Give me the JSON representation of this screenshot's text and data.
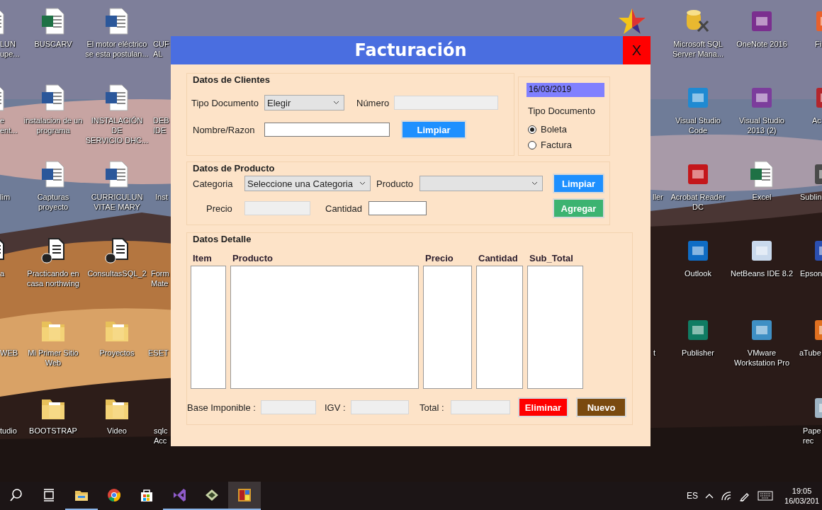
{
  "desktop": {
    "icons": [
      {
        "kind": "word",
        "label": "LUN\nupe..."
      },
      {
        "kind": "excel",
        "label": "BUSCARV"
      },
      {
        "kind": "word",
        "label": "El motor eléctrico\nse esta postulan..."
      },
      {
        "kind": "none",
        "label": "CUF\nAL"
      },
      {
        "kind": "star"
      },
      {
        "kind": "database",
        "label": "Microsoft SQL\nServer Mana..."
      },
      {
        "kind": "app",
        "color": "#7b2f8f",
        "label": "OneNote 2016"
      },
      {
        "kind": "app",
        "color": "#e8612c",
        "label": "Fi"
      },
      {
        "kind": "word",
        "label": "e\nent..."
      },
      {
        "kind": "word",
        "label": "instalacion de un\nprograma"
      },
      {
        "kind": "word",
        "label": "INSTALACIÓN DE\nSERVICIO DHC..."
      },
      {
        "kind": "none",
        "label": "DEB\nIDE"
      },
      {
        "kind": "app",
        "color": "#1f8ad2",
        "label": "Visual Studio\nCode"
      },
      {
        "kind": "app",
        "color": "#7c3d9c",
        "label": "Visual Studio\n2013 (2)"
      },
      {
        "kind": "app",
        "color": "#b3262c",
        "label": "Ac"
      },
      {
        "kind": "none",
        "label": "lim"
      },
      {
        "kind": "word",
        "label": "Capturas\nproyecto"
      },
      {
        "kind": "word",
        "label": "CURRICULUN\nVITAE MARY"
      },
      {
        "kind": "none",
        "label": "Inst"
      },
      {
        "kind": "none",
        "label": "ller"
      },
      {
        "kind": "app",
        "color": "#c4171b",
        "label": "Acrobat Reader\nDC"
      },
      {
        "kind": "excel",
        "label": "Excel"
      },
      {
        "kind": "app",
        "color": "#4a4a4a",
        "label": "Sublin"
      },
      {
        "kind": "sqldoc",
        "label": "a"
      },
      {
        "kind": "sqldoc",
        "label": "Practicando en\ncasa northwing"
      },
      {
        "kind": "sqldoc",
        "label": "ConsultasSQL_2"
      },
      {
        "kind": "none",
        "label": "Form\nMate"
      },
      {
        "kind": "app",
        "color": "#0f6cc4",
        "label": "Outlook"
      },
      {
        "kind": "app",
        "color": "#c9d9ec",
        "label": "NetBeans IDE 8.2"
      },
      {
        "kind": "app",
        "color": "#2b4fb0",
        "label": "Epson"
      },
      {
        "kind": "none",
        "label": "WEB"
      },
      {
        "kind": "folder",
        "label": "Mi Primer Sitio\nWeb"
      },
      {
        "kind": "folder",
        "label": "Proyectos"
      },
      {
        "kind": "none",
        "label": "ESET"
      },
      {
        "kind": "none",
        "label": "t"
      },
      {
        "kind": "app",
        "color": "#107c63",
        "label": "Publisher"
      },
      {
        "kind": "app",
        "color": "#3f8fc4",
        "label": "VMware\nWorkstation Pro"
      },
      {
        "kind": "app",
        "color": "#e07020",
        "label": "aTube"
      },
      {
        "kind": "none",
        "label": "tudio"
      },
      {
        "kind": "folder",
        "label": "BOOTSTRAP"
      },
      {
        "kind": "folder",
        "label": "Video"
      },
      {
        "kind": "none",
        "label": "sqlc\nAcc"
      },
      {
        "kind": "app",
        "color": "#9fb4c4",
        "label": "Pape\nrec"
      }
    ]
  },
  "window": {
    "title": "Facturación",
    "close": "X",
    "clientes": {
      "title": "Datos de Clientes",
      "tipo_label": "Tipo Documento",
      "tipo_select": "Elegir",
      "numero_label": "Número",
      "numero_field": {
        "disabled": true
      },
      "nombre_label": "Nombre/Razon",
      "nombre_field": {
        "disabled": false
      },
      "clear_button": "Limpiar"
    },
    "fecha": {
      "date": "16/03/2019",
      "tipo_label": "Tipo Documento",
      "options": [
        {
          "label": "Boleta",
          "selected": true
        },
        {
          "label": "Factura",
          "selected": false
        }
      ]
    },
    "producto": {
      "title": "Datos de Producto",
      "categoria_label": "Categoria",
      "categoria_select": "Seleccione una Categoria",
      "producto_label": "Producto",
      "precio_label": "Precio",
      "precio_field": {
        "disabled": true
      },
      "cantidad_label": "Cantidad",
      "cantidad_field": {
        "disabled": false
      },
      "clear_button": "Limpiar",
      "add_button": "Agregar"
    },
    "detalle": {
      "title": "Datos Detalle",
      "columns": [
        "Item",
        "Producto",
        "Precio",
        "Cantidad",
        "Sub_Total"
      ],
      "base_label": "Base Imponible :",
      "base_field": {
        "disabled": true
      },
      "igv_label": "IGV :",
      "igv_field": {
        "disabled": true
      },
      "total_label": "Total :",
      "total_field": {
        "disabled": true
      },
      "delete_button": "Eliminar",
      "new_button": "Nuevo"
    }
  },
  "taskbar": {
    "apps": [
      {
        "kind": "search",
        "running": false,
        "selected": false
      },
      {
        "kind": "task-view",
        "running": false,
        "selected": false
      },
      {
        "kind": "folder",
        "running": true,
        "selected": false
      },
      {
        "kind": "browser",
        "running": false,
        "selected": false
      },
      {
        "kind": "store",
        "running": false,
        "selected": false
      },
      {
        "kind": "studio",
        "running": true,
        "selected": false
      },
      {
        "kind": "app",
        "running": true,
        "selected": false
      },
      {
        "kind": "tiles",
        "running": true,
        "selected": true
      }
    ],
    "language": "ES",
    "time": "19:05",
    "date": "16/03/201"
  }
}
